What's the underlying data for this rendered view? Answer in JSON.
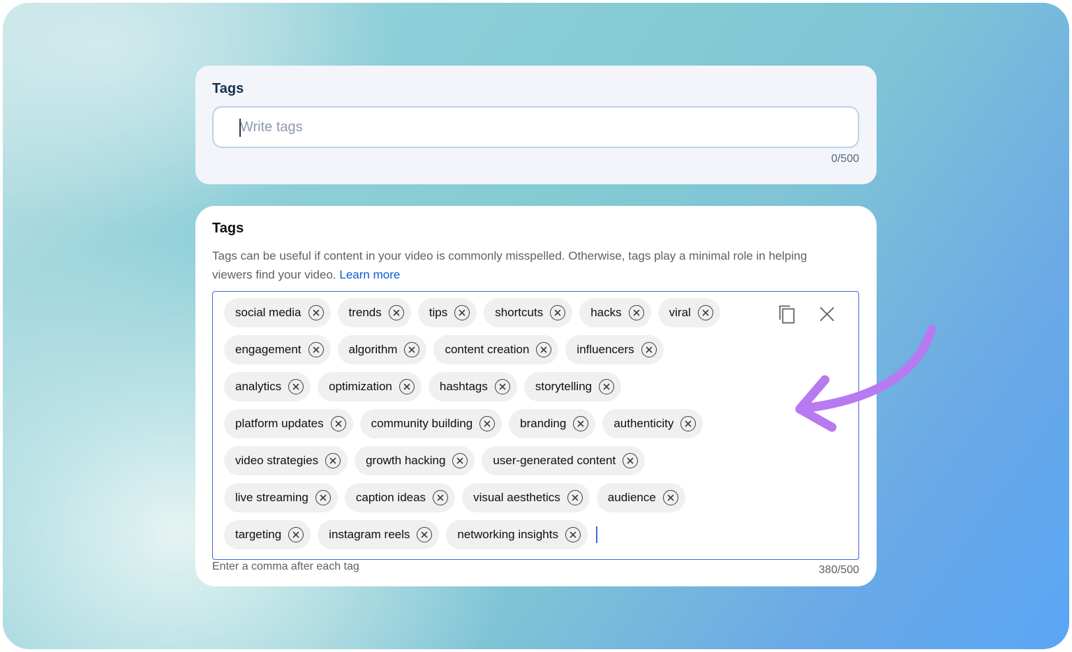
{
  "top_card": {
    "title": "Tags",
    "placeholder": "Write tags",
    "counter": "0/500"
  },
  "tags_card": {
    "title": "Tags",
    "description": "Tags can be useful if content in your video is commonly misspelled. Otherwise, tags play a minimal role in helping viewers find your video.",
    "learn_more": "Learn more",
    "tags": [
      "social media",
      "trends",
      "tips",
      "shortcuts",
      "hacks",
      "viral",
      "engagement",
      "algorithm",
      "content creation",
      "influencers",
      "analytics",
      "optimization",
      "hashtags",
      "storytelling",
      "platform updates",
      "community building",
      "branding",
      "authenticity",
      "video strategies",
      "growth hacking",
      "user-generated content",
      "live streaming",
      "caption ideas",
      "visual aesthetics",
      "audience",
      "targeting",
      "instagram reels",
      "networking insights"
    ],
    "hint": "Enter a comma after each tag",
    "counter": "380/500"
  },
  "icons": {
    "copy": "copy-icon",
    "clear": "close-icon",
    "remove_tag": "remove-circle-icon",
    "annotation": "curved-arrow-icon"
  },
  "colors": {
    "arrow": "#b77af0",
    "accent_border": "#3f6ad8",
    "link": "#065fd4",
    "chip_bg": "#f0f0f0"
  }
}
